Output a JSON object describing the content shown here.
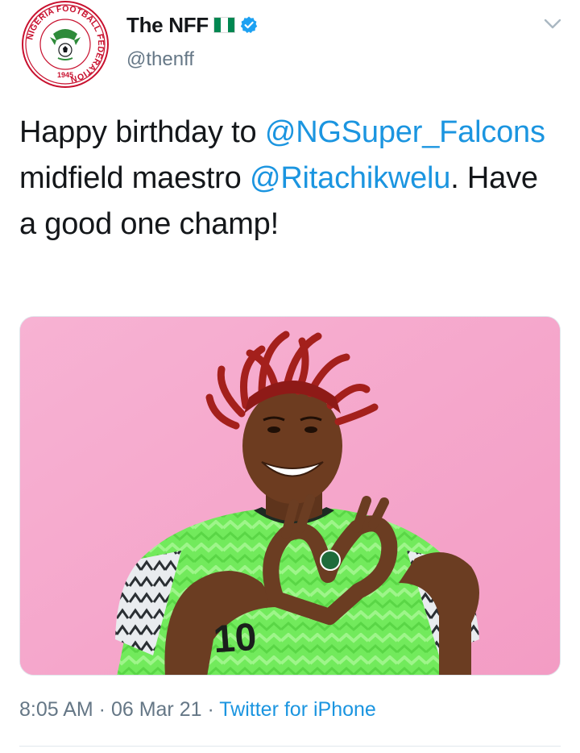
{
  "colors": {
    "link": "#1b95e0",
    "secondary_text": "#657786",
    "primary_text": "#14171a",
    "verified": "#1da1f2",
    "photo_background": "#f4a7c9",
    "jersey_green": "#6ee65a"
  },
  "author": {
    "display_name": "The NFF",
    "handle": "@thenff",
    "flag_icon": "nigeria-flag",
    "verified_icon": "verified-badge"
  },
  "avatar_logo": {
    "ring_text": "NIGERIA FOOTBALL FEDERATION",
    "year": "1945"
  },
  "tweet": {
    "text_part1": "Happy birthday to ",
    "mention1": "@NGSuper_Falcons",
    "text_part2": " midfield maestro ",
    "mention2": "@Ritachikwelu",
    "text_part3": ". Have a good one champ!"
  },
  "media": {
    "jersey_number": "10"
  },
  "meta": {
    "time": "8:05 AM",
    "separator": " · ",
    "date": "06 Mar 21",
    "source": "Twitter for iPhone"
  },
  "icons": {
    "more_menu": "chevron-down-icon"
  }
}
